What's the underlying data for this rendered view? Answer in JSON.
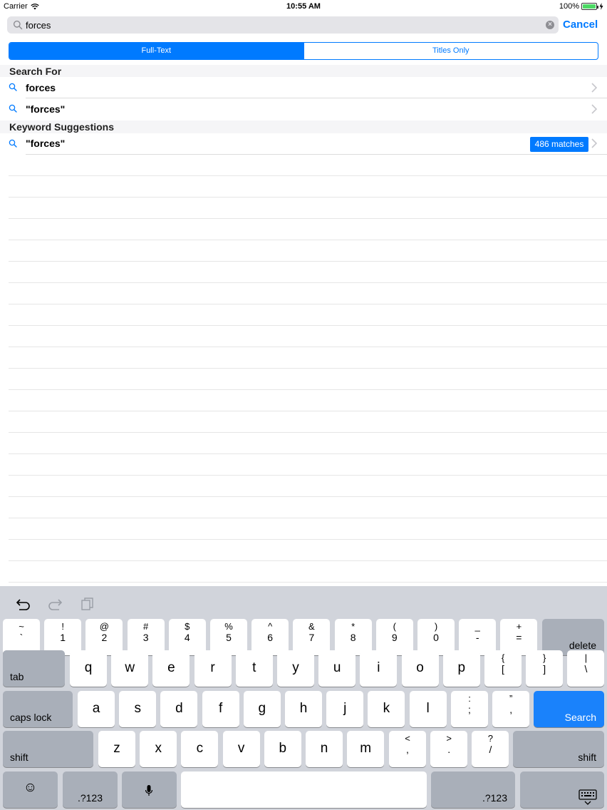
{
  "status_bar": {
    "carrier": "Carrier",
    "time": "10:55 AM",
    "battery": "100%"
  },
  "search": {
    "value": "forces",
    "cancel_label": "Cancel"
  },
  "segments": [
    {
      "label": "Full-Text",
      "active": true
    },
    {
      "label": "Titles Only",
      "active": false
    }
  ],
  "sections": {
    "search_for": {
      "title": "Search For",
      "items": [
        {
          "label": "forces"
        },
        {
          "label": "\"forces\""
        }
      ]
    },
    "keyword_suggestions": {
      "title": "Keyword Suggestions",
      "items": [
        {
          "label": "\"forces\"",
          "badge": "486 matches"
        }
      ]
    }
  },
  "keyboard": {
    "number_row": [
      {
        "top": "~",
        "bottom": "`"
      },
      {
        "top": "!",
        "bottom": "1"
      },
      {
        "top": "@",
        "bottom": "2"
      },
      {
        "top": "#",
        "bottom": "3"
      },
      {
        "top": "$",
        "bottom": "4"
      },
      {
        "top": "%",
        "bottom": "5"
      },
      {
        "top": "^",
        "bottom": "6"
      },
      {
        "top": "&",
        "bottom": "7"
      },
      {
        "top": "*",
        "bottom": "8"
      },
      {
        "top": "(",
        "bottom": "9"
      },
      {
        "top": ")",
        "bottom": "0"
      },
      {
        "top": "_",
        "bottom": "-"
      },
      {
        "top": "+",
        "bottom": "="
      }
    ],
    "delete_label": "delete",
    "tab_label": "tab",
    "row_q": [
      "q",
      "w",
      "e",
      "r",
      "t",
      "y",
      "u",
      "i",
      "o",
      "p"
    ],
    "row_q_extra": [
      {
        "top": "{",
        "bottom": "["
      },
      {
        "top": "}",
        "bottom": "]"
      },
      {
        "top": "|",
        "bottom": "\\"
      }
    ],
    "caps_label": "caps lock",
    "row_a": [
      "a",
      "s",
      "d",
      "f",
      "g",
      "h",
      "j",
      "k",
      "l"
    ],
    "row_a_extra": [
      {
        "top": ":",
        "bottom": ";"
      },
      {
        "top": "”",
        "bottom": ","
      }
    ],
    "search_label": "Search",
    "shift_label": "shift",
    "row_z": [
      "z",
      "x",
      "c",
      "v",
      "b",
      "n",
      "m"
    ],
    "row_z_extra": [
      {
        "top": "<",
        "bottom": ","
      },
      {
        "top": ">",
        "bottom": "."
      },
      {
        "top": "?",
        "bottom": "/"
      }
    ],
    "numbers_label": ".?123",
    "emoji": "☺",
    "mic": "🎙"
  },
  "colors": {
    "accent": "#007aff",
    "keyboard_bg": "#d1d4db",
    "search_key": "#1a82fb"
  }
}
